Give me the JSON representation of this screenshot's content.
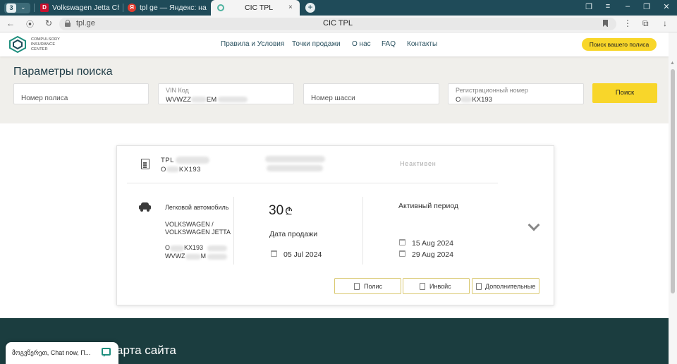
{
  "browser": {
    "tab_count": "3",
    "tabs": [
      {
        "label": "Volkswagen Jetta Charge I",
        "favicon": "D",
        "favicon_color": "#c8102e"
      },
      {
        "label": "tpl ge — Яндекс: нашлось",
        "favicon": "Я",
        "favicon_color": "#e23b2e"
      }
    ],
    "active_tab": {
      "label": "CIC TPL",
      "close": "×"
    },
    "new_tab": "+",
    "url": "tpl.ge",
    "page_title": "CIC TPL"
  },
  "header": {
    "logo_lines": [
      "COMPULSORY",
      "INSURANCE",
      "CENTER"
    ],
    "menu": [
      "Правила и Условия",
      "Точки продажи",
      "О нас",
      "FAQ",
      "Контакты"
    ],
    "cta": "Поиск вашего полиса",
    "accent": "#f8d62a",
    "brand": "#1f4b59"
  },
  "search": {
    "title": "Параметры поиска",
    "policy_placeholder": "Номер полиса",
    "vin_label": "VIN Код",
    "vin_value_start": "WVWZZ",
    "vin_value_end": "EM",
    "chassis_placeholder": "Номер шасси",
    "reg_label": "Регистрационный номер",
    "reg_value_start": "O",
    "reg_value_end": "KX193",
    "button": "Поиск"
  },
  "policy": {
    "title": "TPL",
    "plate_start": "O",
    "plate_end": "KX193",
    "status": "Неактивен",
    "vehicle_type": "Легковой автомобиль",
    "make_model": "VOLKSWAGEN / VOLKSWAGEN JETTA",
    "plate2_start": "O",
    "plate2_end": "KX193",
    "vin_short_start": "WVWZ",
    "vin_short_end": "M",
    "price": "30",
    "currency": "₾",
    "sale_date_label": "Дата продажи",
    "sale_date": "05 Jul 2024",
    "active_period_label": "Активный период",
    "period_start": "15 Aug 2024",
    "period_end": "29 Aug 2024",
    "buttons": [
      "Полис",
      "Инвойс",
      "Дополнительные"
    ]
  },
  "footer": {
    "title": "арта сайта"
  },
  "chat": {
    "text": "მოგვწერეთ, Chat now, П..."
  }
}
